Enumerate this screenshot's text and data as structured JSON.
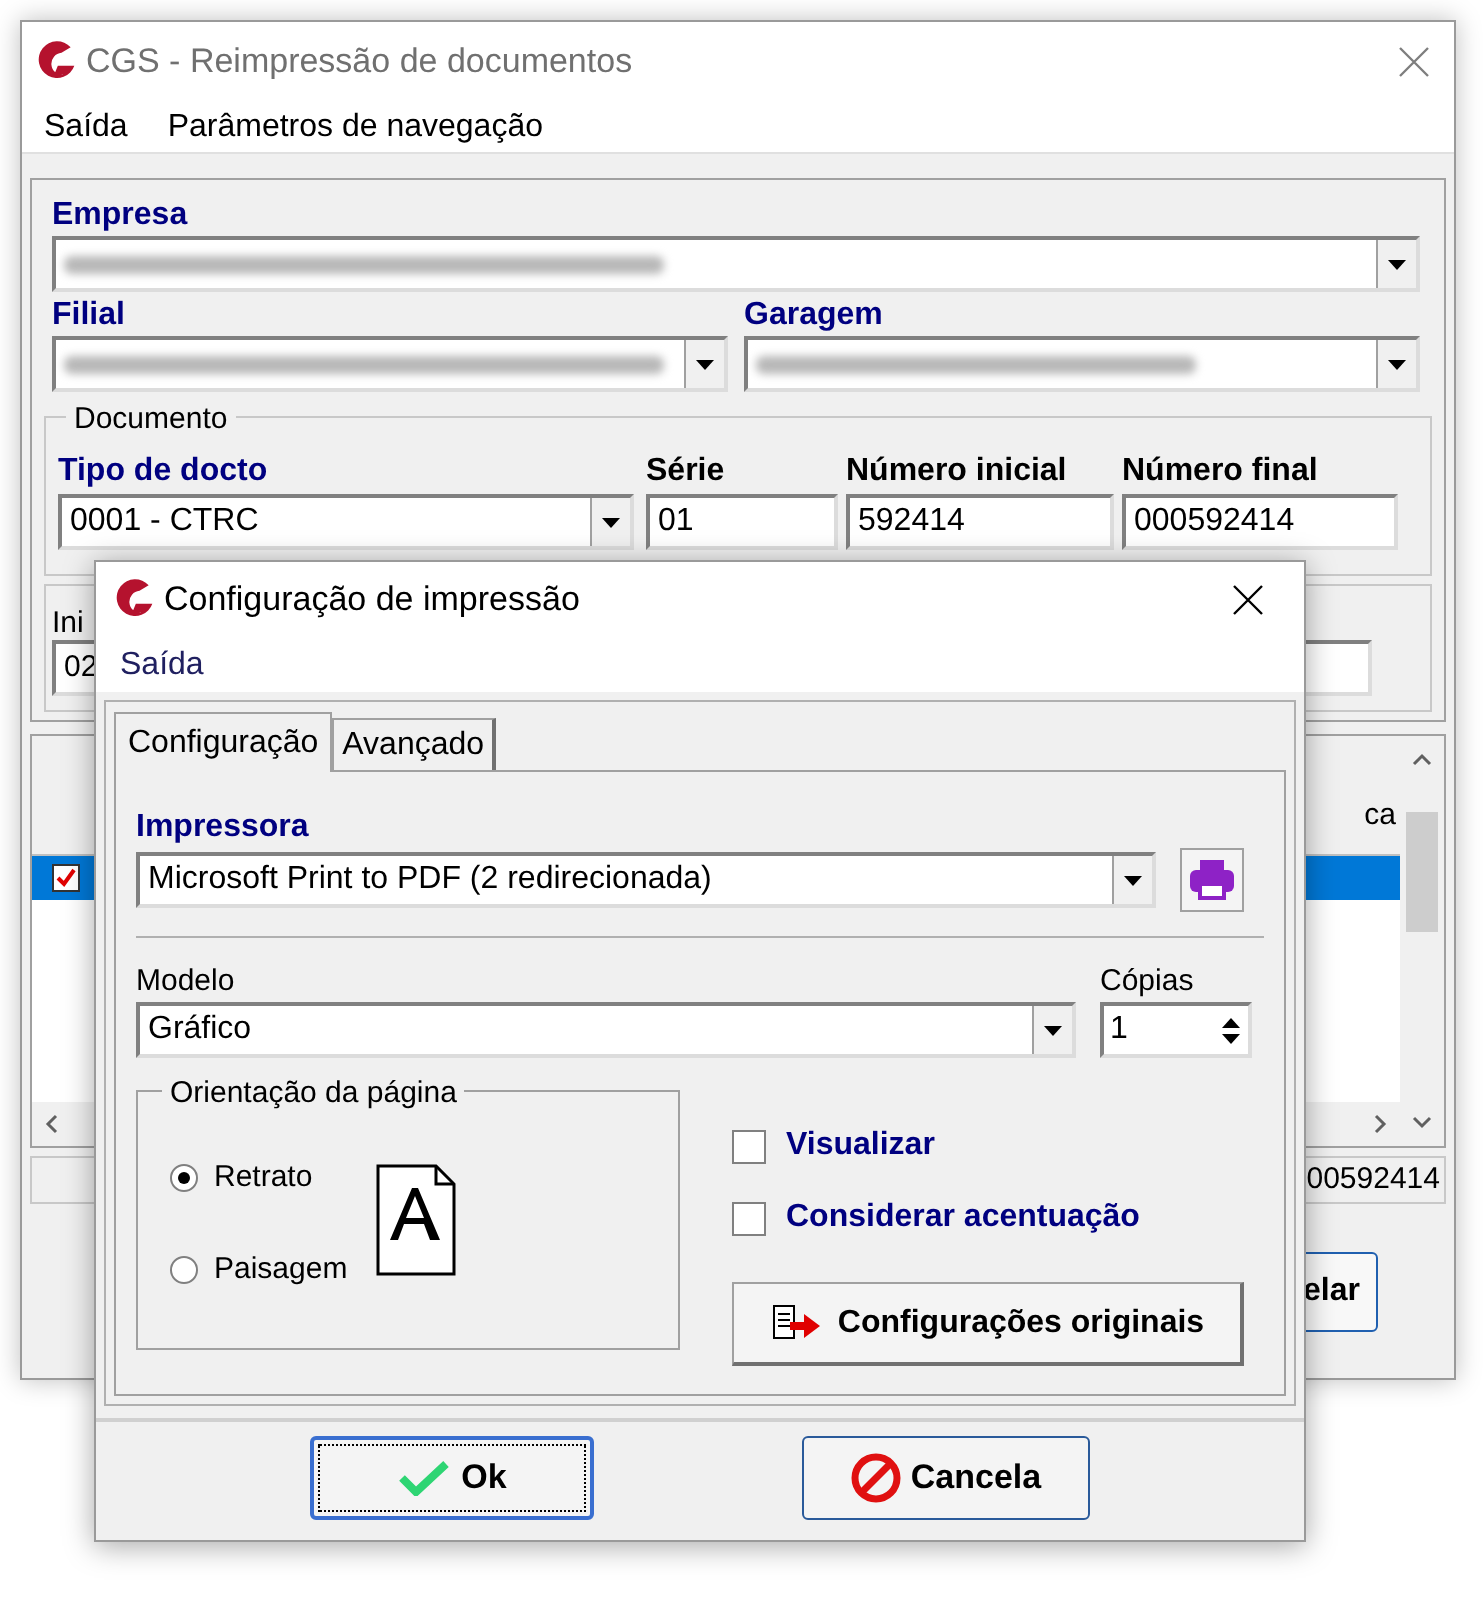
{
  "main_window": {
    "title": "CGS - Reimpressão de documentos",
    "menu": [
      "Saída",
      "Parâmetros de navegação"
    ],
    "empresa_label": "Empresa",
    "filial_label": "Filial",
    "garagem_label": "Garagem",
    "documento": {
      "legend": "Documento",
      "tipo_label": "Tipo de docto",
      "tipo_value": "0001 - CTRC",
      "serie_label": "Série",
      "serie_value": "01",
      "numero_inicial_label": "Número inicial",
      "numero_inicial_value": "592414",
      "numero_final_label": "Número final",
      "numero_final_value": "000592414"
    },
    "partial": {
      "label": "Ini",
      "value": "02",
      "column_header": "ca",
      "row_checked": true,
      "status_value": "00592414",
      "button": "elar"
    }
  },
  "dialog": {
    "title": "Configuração de impressão",
    "menu": [
      "Saída"
    ],
    "tabs": [
      {
        "label": "Configuração",
        "selected": true
      },
      {
        "label": "Avançado",
        "selected": false
      }
    ],
    "impressora_label": "Impressora",
    "impressora_value": "Microsoft Print to PDF (2 redirecionada)",
    "modelo_label": "Modelo",
    "modelo_value": "Gráfico",
    "copias_label": "Cópias",
    "copias_value": "1",
    "orientacao": {
      "legend": "Orientação da página",
      "options": [
        {
          "label": "Retrato",
          "selected": true
        },
        {
          "label": "Paisagem",
          "selected": false
        }
      ]
    },
    "checkboxes": [
      {
        "label": "Visualizar",
        "checked": false
      },
      {
        "label": "Considerar acentuação",
        "checked": false
      }
    ],
    "reset_button": "Configurações originais",
    "ok_button": "Ok",
    "cancel_button": "Cancela"
  }
}
